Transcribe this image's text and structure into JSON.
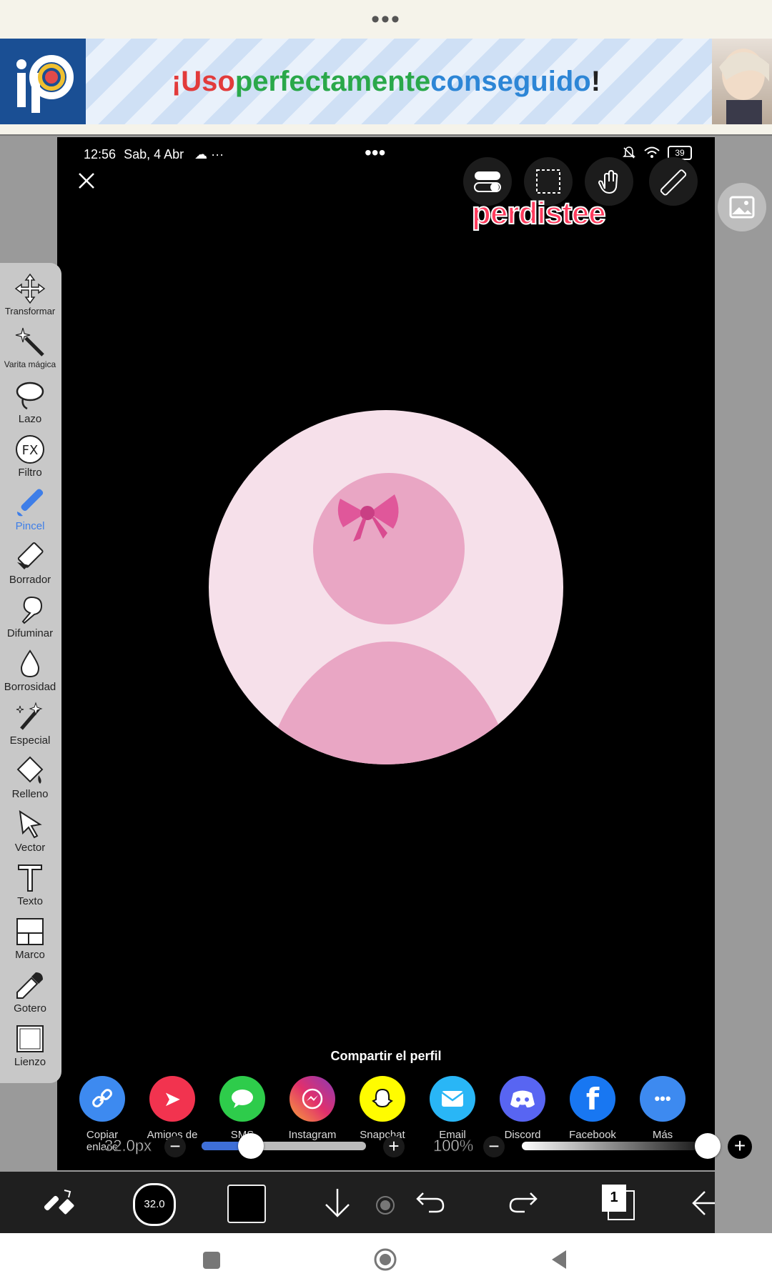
{
  "top_menu": "•••",
  "ad": {
    "logo": "iP",
    "part1": "¡Uso ",
    "part2": "perfectamente ",
    "part3": "conseguido",
    "part4": "!",
    "colors": {
      "part1": "#e23b3b",
      "part2": "#2aa84a",
      "part3": "#2d86d6",
      "part4": "#222222"
    }
  },
  "status": {
    "time": "12:56",
    "date": "Sab, 4 Abr",
    "extra": "☁ ···",
    "center_menu": "•••",
    "battery": "39"
  },
  "overlay_text": "perdistee",
  "share": {
    "title": "Compartir el perfil",
    "items": [
      {
        "label": "Copiar\nenlace",
        "color": "#3d8af0",
        "glyph": "🔗"
      },
      {
        "label": "Amigos de",
        "color": "#f2334f",
        "glyph": "➤"
      },
      {
        "label": "SMS",
        "color": "#2ecc4b",
        "glyph": "💬"
      },
      {
        "label": "Instagram\nDirect",
        "color": "#c13584",
        "glyph": "◎"
      },
      {
        "label": "Snapchat",
        "color": "#fffc00",
        "glyph": "👻"
      },
      {
        "label": "Email",
        "color": "#29b6f6",
        "glyph": "✉"
      },
      {
        "label": "Discord",
        "color": "#5865f2",
        "glyph": "☺"
      },
      {
        "label": "Facebook",
        "color": "#1877f2",
        "glyph": "f"
      },
      {
        "label": "Más",
        "color": "#3d8af0",
        "glyph": "•••"
      }
    ]
  },
  "tools": [
    {
      "label": "Transformar",
      "icon": "move-icon"
    },
    {
      "label": "Varita mágica",
      "icon": "magic-wand-icon"
    },
    {
      "label": "Lazo",
      "icon": "lasso-icon"
    },
    {
      "label": "Filtro",
      "icon": "fx-icon"
    },
    {
      "label": "Pincel",
      "icon": "brush-icon",
      "active": true
    },
    {
      "label": "Borrador",
      "icon": "eraser-icon"
    },
    {
      "label": "Difuminar",
      "icon": "smudge-icon"
    },
    {
      "label": "Borrosidad",
      "icon": "blur-drop-icon"
    },
    {
      "label": "Especial",
      "icon": "special-icon"
    },
    {
      "label": "Relleno",
      "icon": "bucket-icon"
    },
    {
      "label": "Vector",
      "icon": "cursor-icon"
    },
    {
      "label": "Texto",
      "icon": "text-icon"
    },
    {
      "label": "Marco",
      "icon": "frame-icon"
    },
    {
      "label": "Gotero",
      "icon": "dropper-icon"
    },
    {
      "label": "Lienzo",
      "icon": "canvas-icon"
    }
  ],
  "sliders": {
    "size_value": "32.0px",
    "size_fraction": 0.3,
    "opacity_value": "100%",
    "opacity_fraction": 1.0
  },
  "bottom_bar": {
    "brush_size": "32.0",
    "layers_count": "1"
  }
}
